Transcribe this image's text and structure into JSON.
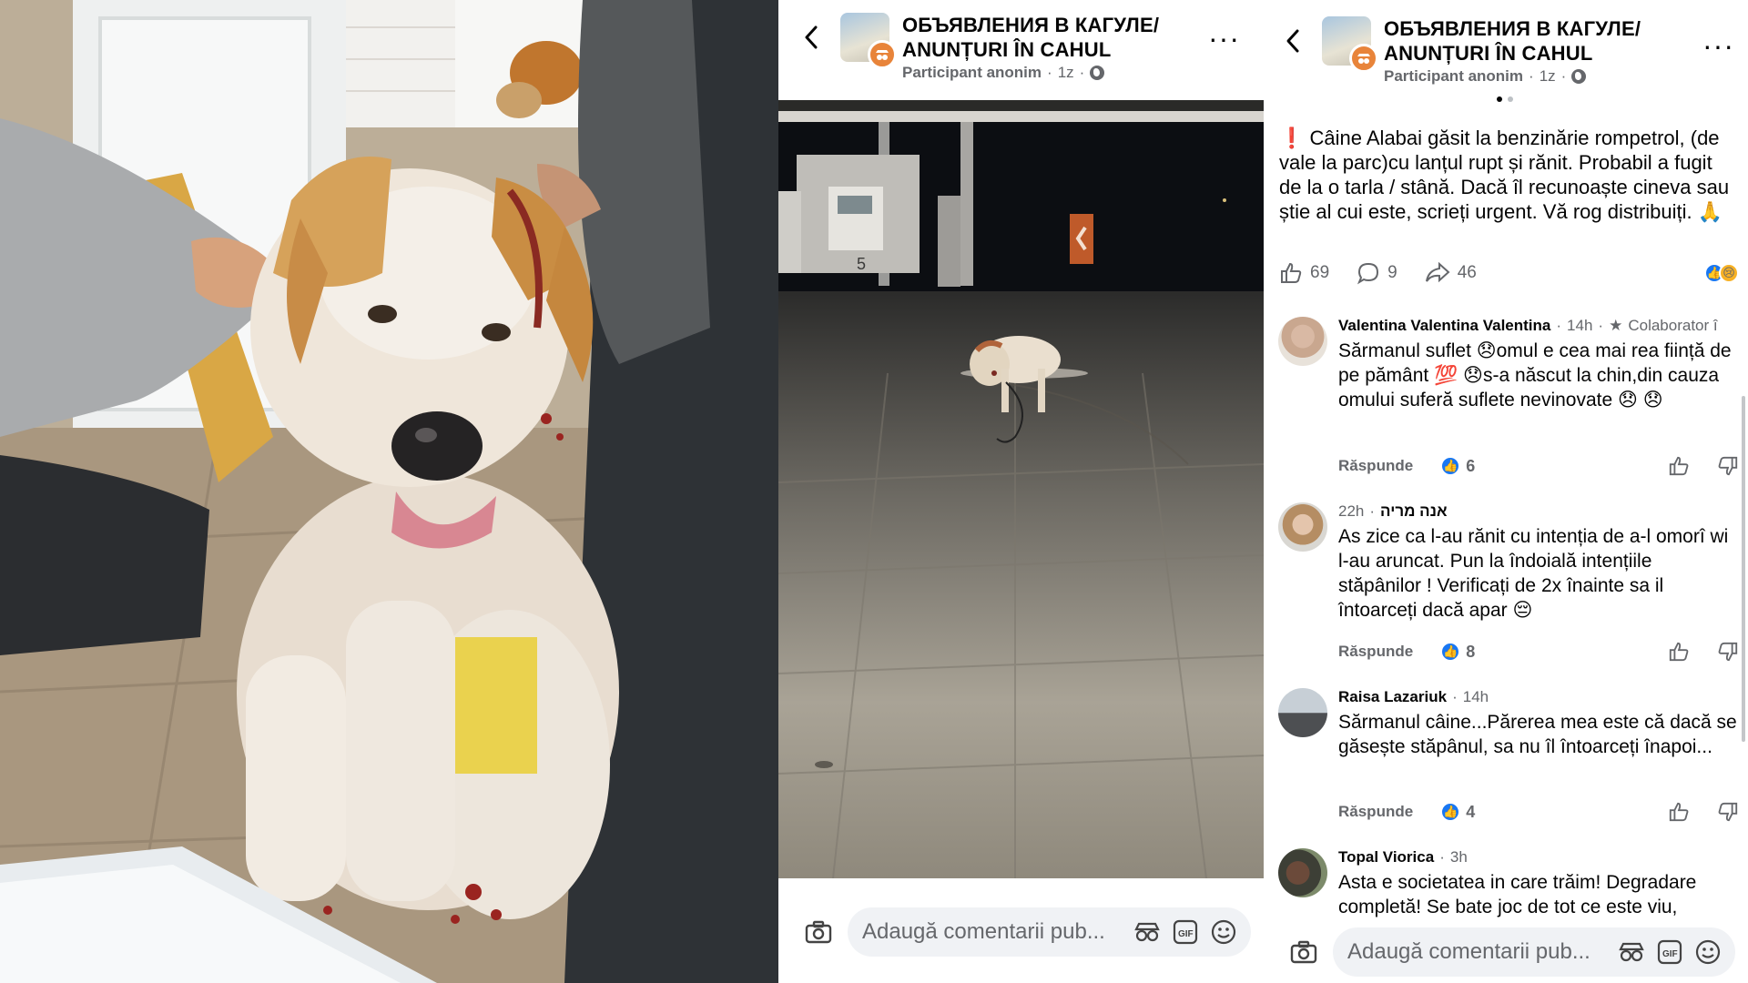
{
  "video_post": {
    "group_title_line1": "ОБЪЯВЛЕНИЯ В КАГУЛЕ/",
    "group_title_line2": "ANUNȚURI ÎN CAHUL",
    "author": "Participant anonim",
    "time": "1z",
    "pump_number": "5"
  },
  "text_post": {
    "group_title_line1": "ОБЪЯВЛЕНИЯ В КАГУЛЕ/",
    "group_title_line2": "ANUNȚURI ÎN CAHUL",
    "author": "Participant anonim",
    "time": "1z",
    "body": "❗ Câine Alabai găsit la benzinărie rompetrol, (de vale la parc)cu lanțul rupt și rănit. Probabil a fugit de la o tarla / stână. Dacă îl recunoaște cineva sau știe al cui este, scrieți urgent. Vă rog distribuiți. 🙏",
    "likes": "69",
    "comments": "9",
    "shares": "46"
  },
  "comments": [
    {
      "name": "Valentina Valentina Valentina",
      "time": "14h",
      "role": "Colaborator î",
      "text": "Sărmanul suflet 😞omul e cea mai rea ființă de pe pământ 💯 😞s-a născut la chin,din cauza omului suferă suflete nevinovate 😞 😞",
      "reply": "Răspunde",
      "likes": "6"
    },
    {
      "name": "אנה מריה",
      "time": "22h",
      "text": "As zice ca l-au rănit cu intenția de a-l omorî wi l-au aruncat. Pun la îndoială intențiile stăpânilor ! Verificați de 2x înainte sa il întoarceți dacă apar 😔",
      "reply": "Răspunde",
      "likes": "8"
    },
    {
      "name": "Raisa Lazariuk",
      "time": "14h",
      "text": "Sărmanul câine...Părerea mea este că dacă se găsește stăpânul, sa nu îl întoarceți înapoi...",
      "reply": "Răspunde",
      "likes": "4"
    },
    {
      "name": "Topal Viorica",
      "time": "3h",
      "text": "Asta e societatea in care trăim! Degradare completă! Se bate joc de tot ce este viu,"
    }
  ],
  "comment_input": {
    "placeholder": "Adaugă comentarii pub..."
  },
  "colors": {
    "accent": "#1877f2",
    "secondary_text": "#65676b",
    "input_bg": "#f0f2f5",
    "badge_orange": "#e8843a"
  },
  "icons": [
    "back-arrow-icon",
    "more-icon",
    "globe-icon",
    "camera-icon",
    "avatar-icon",
    "gif-icon",
    "emoji-icon",
    "like-icon",
    "comment-icon",
    "share-icon",
    "dislike-icon"
  ]
}
